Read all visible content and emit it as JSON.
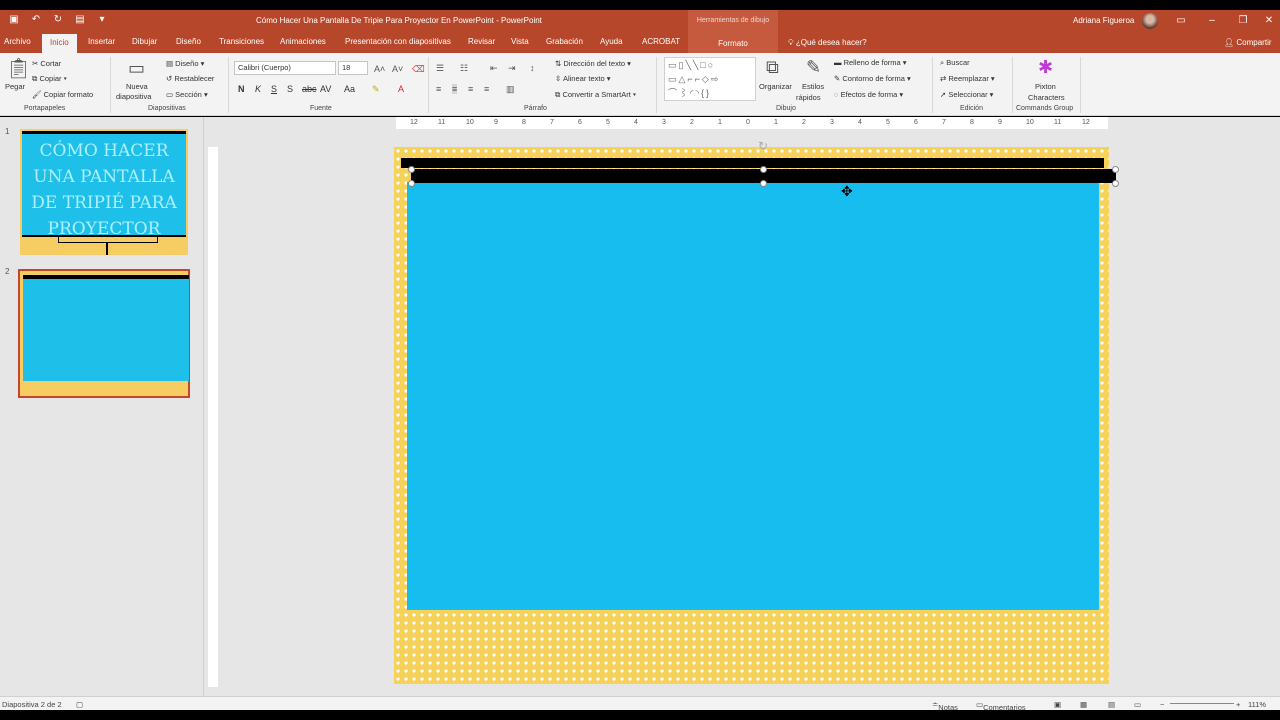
{
  "titlebar": {
    "doc_title": "Cómo Hacer Una Pantalla De Tripie Para Proyector En PowerPoint  -  PowerPoint",
    "context_tab": "Herramientas de dibujo",
    "user_name": "Adriana Figueroa"
  },
  "tabs": [
    "Archivo",
    "Inicio",
    "Insertar",
    "Dibujar",
    "Diseño",
    "Transiciones",
    "Animaciones",
    "Presentación con diapositivas",
    "Revisar",
    "Vista",
    "Grabación",
    "Ayuda",
    "ACROBAT",
    "Formato"
  ],
  "active_tab": "Inicio",
  "tell_me": "¿Qué desea hacer?",
  "share": "Compartir",
  "ribbon": {
    "portapapeles": {
      "pegar": "Pegar",
      "cortar": "Cortar",
      "copiar": "Copiar",
      "copiar_formato": "Copiar formato",
      "label": "Portapapeles"
    },
    "diapositivas": {
      "nueva": "Nueva",
      "nueva2": "diapositiva",
      "diseno": "Diseño",
      "restablecer": "Restablecer",
      "seccion": "Sección",
      "label": "Diapositivas"
    },
    "fuente": {
      "font": "Calibri (Cuerpo)",
      "size": "18",
      "label": "Fuente"
    },
    "parrafo": {
      "direccion": "Dirección del texto",
      "alinear": "Alinear texto",
      "smartart": "Convertir a SmartArt",
      "label": "Párrafo"
    },
    "dibujo": {
      "organizar": "Organizar",
      "estilos": "Estilos",
      "rapidos": "rápidos",
      "relleno": "Relleno de forma",
      "contorno": "Contorno de forma",
      "efectos": "Efectos de forma",
      "label": "Dibujo"
    },
    "edicion": {
      "buscar": "Buscar",
      "reemplazar": "Reemplazar",
      "seleccionar": "Seleccionar",
      "label": "Edición"
    },
    "commands": {
      "pixton": "Pixton",
      "characters": "Characters",
      "label": "Commands Group"
    }
  },
  "thumbnails": [
    {
      "number": "1",
      "title": "CÓMO HACER UNA PANTALLA DE TRIPIÉ PARA PROYECTOR"
    },
    {
      "number": "2"
    }
  ],
  "ruler_ticks": [
    "12",
    "11",
    "10",
    "9",
    "8",
    "7",
    "6",
    "5",
    "4",
    "3",
    "2",
    "1",
    "0",
    "1",
    "2",
    "3",
    "4",
    "5",
    "6",
    "7",
    "8",
    "9",
    "10",
    "11",
    "12"
  ],
  "statusbar": {
    "slide_info": "Diapositiva 2 de 2",
    "notas": "Notas",
    "comentarios": "Comentarios",
    "zoom": "111%"
  },
  "colors": {
    "accent": "#b7472a",
    "screen": "#17bdee",
    "frame": "#f7d25a"
  }
}
